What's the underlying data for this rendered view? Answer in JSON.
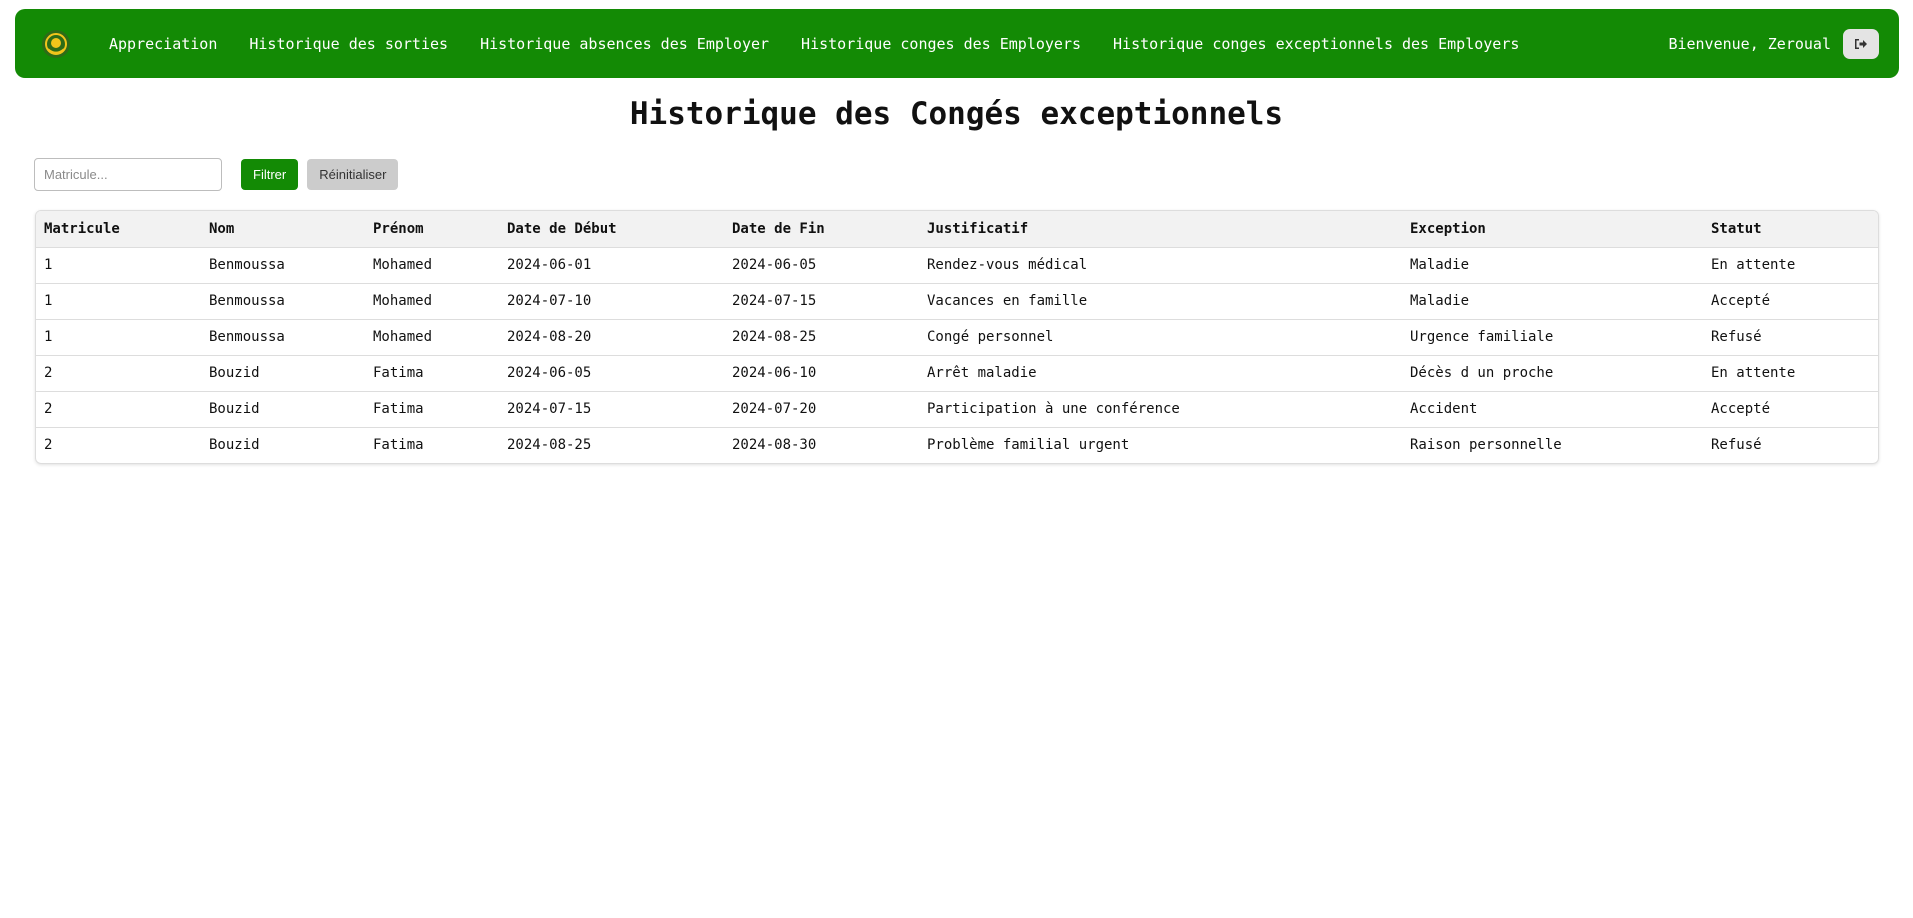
{
  "colors": {
    "navbar_bg": "#138a05",
    "filter_button_bg": "#138a05",
    "logo_outer": "#2e6b17",
    "logo_inner": "#f2c51b"
  },
  "navbar": {
    "logo_icon": "emblem-icon",
    "links": [
      {
        "label": "Appreciation"
      },
      {
        "label": "Historique des sorties"
      },
      {
        "label": "Historique absences des Employer"
      },
      {
        "label": "Historique conges des Employers"
      },
      {
        "label": "Historique conges exceptionnels des Employers"
      }
    ],
    "welcome_text": "Bienvenue, Zeroual",
    "logout_icon": "logout-icon"
  },
  "page": {
    "title": "Historique des Congés exceptionnels"
  },
  "filter": {
    "input_placeholder": "Matricule...",
    "input_value": "",
    "filter_label": "Filtrer",
    "reset_label": "Réinitialiser"
  },
  "table": {
    "headers": [
      "Matricule",
      "Nom",
      "Prénom",
      "Date de Début",
      "Date de Fin",
      "Justificatif",
      "Exception",
      "Statut"
    ],
    "rows": [
      [
        "1",
        "Benmoussa",
        "Mohamed",
        "2024-06-01",
        "2024-06-05",
        "Rendez-vous médical",
        "Maladie",
        "En attente"
      ],
      [
        "1",
        "Benmoussa",
        "Mohamed",
        "2024-07-10",
        "2024-07-15",
        "Vacances en famille",
        "Maladie",
        "Accepté"
      ],
      [
        "1",
        "Benmoussa",
        "Mohamed",
        "2024-08-20",
        "2024-08-25",
        "Congé personnel",
        "Urgence familiale",
        "Refusé"
      ],
      [
        "2",
        "Bouzid",
        "Fatima",
        "2024-06-05",
        "2024-06-10",
        "Arrêt maladie",
        "Décès d un proche",
        "En attente"
      ],
      [
        "2",
        "Bouzid",
        "Fatima",
        "2024-07-15",
        "2024-07-20",
        "Participation à une conférence",
        "Accident",
        "Accepté"
      ],
      [
        "2",
        "Bouzid",
        "Fatima",
        "2024-08-25",
        "2024-08-30",
        "Problème familial urgent",
        "Raison personnelle",
        "Refusé"
      ]
    ]
  }
}
